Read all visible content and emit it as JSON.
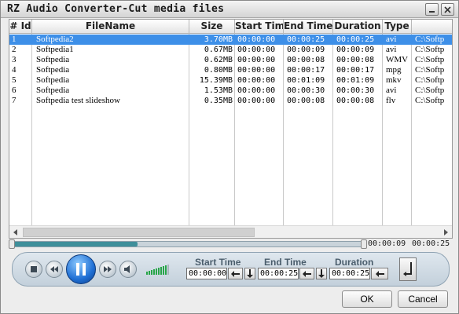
{
  "window": {
    "title": "RZ Audio Converter-Cut media files"
  },
  "table": {
    "columns": [
      "# Id",
      "FileName",
      "Size",
      "Start Time",
      "End Time",
      "Duration",
      "Type",
      ""
    ],
    "rows": [
      {
        "id": "1",
        "name": "Softpedia2",
        "size": "3.70MB",
        "start": "00:00:00",
        "end": "00:00:25",
        "duration": "00:00:25",
        "type": "avi",
        "path": "C:\\Softp",
        "selected": true
      },
      {
        "id": "2",
        "name": "Softpedia1",
        "size": "0.67MB",
        "start": "00:00:00",
        "end": "00:00:09",
        "duration": "00:00:09",
        "type": "avi",
        "path": "C:\\Softp",
        "selected": false
      },
      {
        "id": "3",
        "name": "Softpedia",
        "size": "0.62MB",
        "start": "00:00:00",
        "end": "00:00:08",
        "duration": "00:00:08",
        "type": "WMV",
        "path": "C:\\Softp",
        "selected": false
      },
      {
        "id": "4",
        "name": "Softpedia",
        "size": "0.80MB",
        "start": "00:00:00",
        "end": "00:00:17",
        "duration": "00:00:17",
        "type": "mpg",
        "path": "C:\\Softp",
        "selected": false
      },
      {
        "id": "5",
        "name": "Softpedia",
        "size": "15.39MB",
        "start": "00:00:00",
        "end": "00:01:09",
        "duration": "00:01:09",
        "type": "mkv",
        "path": "C:\\Softp",
        "selected": false
      },
      {
        "id": "6",
        "name": "Softpedia",
        "size": "1.53MB",
        "start": "00:00:00",
        "end": "00:00:30",
        "duration": "00:00:30",
        "type": "avi",
        "path": "C:\\Softp",
        "selected": false
      },
      {
        "id": "7",
        "name": "Softpedia test slideshow",
        "size": "0.35MB",
        "start": "00:00:00",
        "end": "00:00:08",
        "duration": "00:00:08",
        "type": "flv",
        "path": "C:\\Softp",
        "selected": false
      }
    ]
  },
  "seek": {
    "current": "00:00:09",
    "total": "00:00:25",
    "progress": 0.36
  },
  "player": {
    "volume_level": 0.9,
    "icons": [
      "stop-icon",
      "rewind-icon",
      "pause-icon",
      "forward-icon",
      "mute-icon"
    ],
    "accent": "#1f6fd4",
    "volume_color": "#27a548"
  },
  "range": {
    "start_label": "Start Time",
    "end_label": "End Time",
    "duration_label": "Duration",
    "start_value": "00:00:00",
    "end_value": "00:00:25",
    "duration_value": "00:00:25"
  },
  "buttons": {
    "ok": "OK",
    "cancel": "Cancel"
  },
  "colors": {
    "selection": "#3d8fe8",
    "seek_fill": "#3f8f9a"
  }
}
